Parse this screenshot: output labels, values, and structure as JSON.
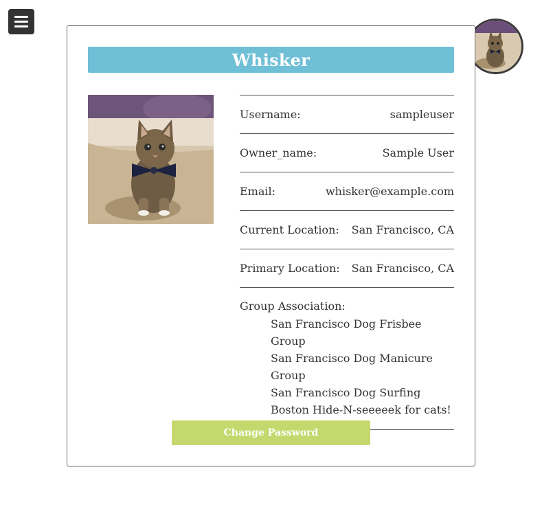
{
  "icons": {
    "menu": "hamburger-menu-icon"
  },
  "profile": {
    "name": "Whisker",
    "fields": [
      {
        "label": "Username:",
        "value": "sampleuser"
      },
      {
        "label": "Owner_name:",
        "value": "Sample User"
      },
      {
        "label": "Email:",
        "value": "whisker@example.com"
      },
      {
        "label": "Current Location:",
        "value": "San Francisco, CA"
      },
      {
        "label": "Primary Location:",
        "value": "San Francisco, CA"
      }
    ],
    "group_label": "Group Association:",
    "groups": [
      "San Francisco Dog Frisbee Group",
      "San Francisco Dog Manicure Group",
      "San Francisco Dog Surfing",
      "Boston Hide-N-seeeeek for cats!"
    ]
  },
  "actions": {
    "change_password": "Change Password"
  },
  "colors": {
    "title_bar": "#6fbfd6",
    "button": "#c4d86e",
    "menu_button": "#333333"
  }
}
